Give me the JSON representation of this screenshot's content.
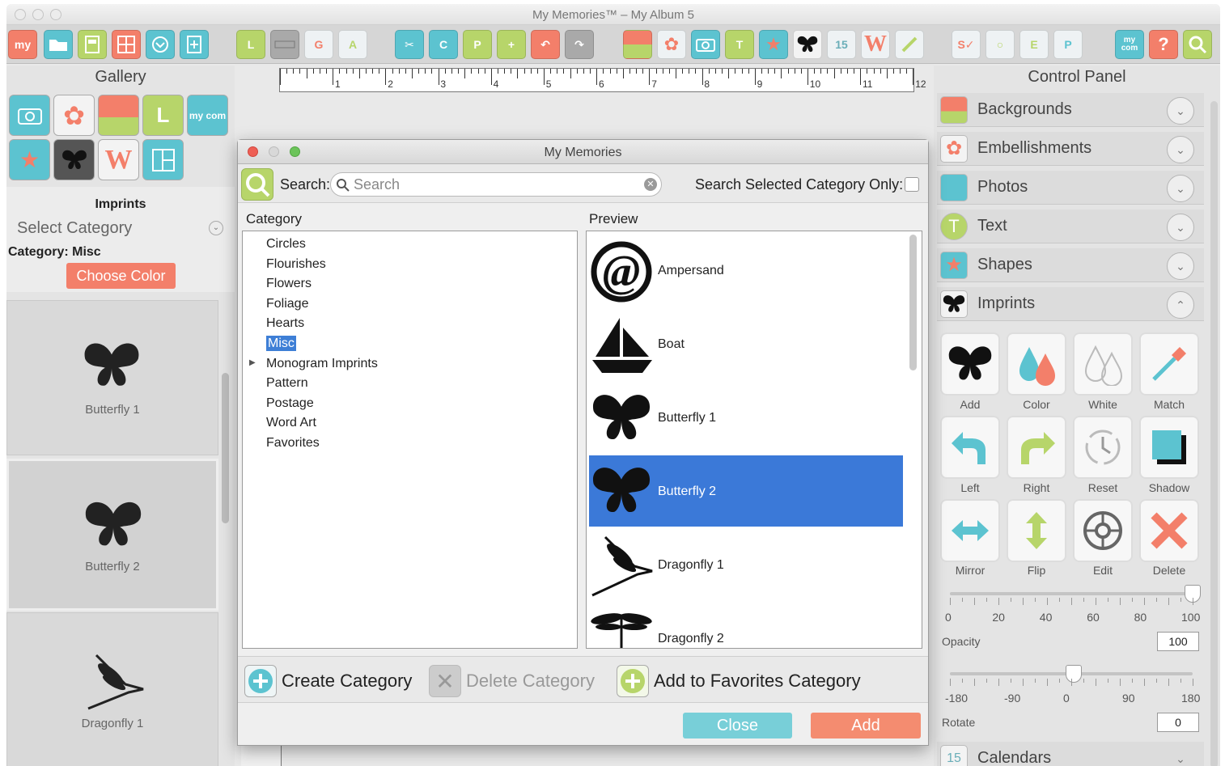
{
  "window": {
    "title": "My Memories™ – My Album 5"
  },
  "toolbar": {
    "my_label": "my",
    "mycom_label": "my com",
    "calendar_day": "15",
    "w_letter": "W"
  },
  "gallery": {
    "title": "Gallery",
    "section": "Imprints",
    "select_category": "Select Category",
    "category_label": "Category: Misc",
    "choose_color": "Choose Color",
    "items": [
      {
        "label": "Butterfly 1"
      },
      {
        "label": "Butterfly 2"
      },
      {
        "label": "Dragonfly 1"
      }
    ]
  },
  "ruler": {
    "marks": [
      "1",
      "2",
      "3",
      "4",
      "5",
      "6",
      "7",
      "8",
      "9",
      "10",
      "11",
      "12"
    ]
  },
  "dialog": {
    "title": "My Memories",
    "search_label": "Search:",
    "search_placeholder": "Search",
    "search_selected_only": "Search Selected Category Only:",
    "category_header": "Category",
    "preview_header": "Preview",
    "categories": [
      "Circles",
      "Flourishes",
      "Flowers",
      "Foliage",
      "Hearts",
      "Misc",
      "Monogram Imprints",
      "Pattern",
      "Postage",
      "Word Art",
      "Favorites"
    ],
    "selected_category": "Misc",
    "previews": [
      {
        "name": "Ampersand"
      },
      {
        "name": "Boat"
      },
      {
        "name": "Butterfly 1"
      },
      {
        "name": "Butterfly 2"
      },
      {
        "name": "Dragonfly 1"
      },
      {
        "name": "Dragonfly 2"
      }
    ],
    "selected_preview": "Butterfly 2",
    "create_category": "Create Category",
    "delete_category": "Delete Category",
    "add_favorites": "Add to Favorites Category",
    "close": "Close",
    "add": "Add"
  },
  "control_panel": {
    "title": "Control Panel",
    "sections": [
      "Backgrounds",
      "Embellishments",
      "Photos",
      "Text",
      "Shapes",
      "Imprints"
    ],
    "bottom_section": "Calendars",
    "tools": [
      "Add",
      "Color",
      "White",
      "Match",
      "Left",
      "Right",
      "Reset",
      "Shadow",
      "Mirror",
      "Flip",
      "Edit",
      "Delete"
    ],
    "opacity_label": "Opacity",
    "opacity_value": "100",
    "opacity_ticks": [
      "0",
      "20",
      "40",
      "60",
      "80",
      "100"
    ],
    "rotate_label": "Rotate",
    "rotate_value": "0",
    "rotate_ticks": [
      "-180",
      "-90",
      "0",
      "90",
      "180"
    ]
  },
  "colors": {
    "teal": "#5cc3d0",
    "green": "#b7d56a",
    "coral": "#f37f6a",
    "selection": "#3b79d8"
  }
}
